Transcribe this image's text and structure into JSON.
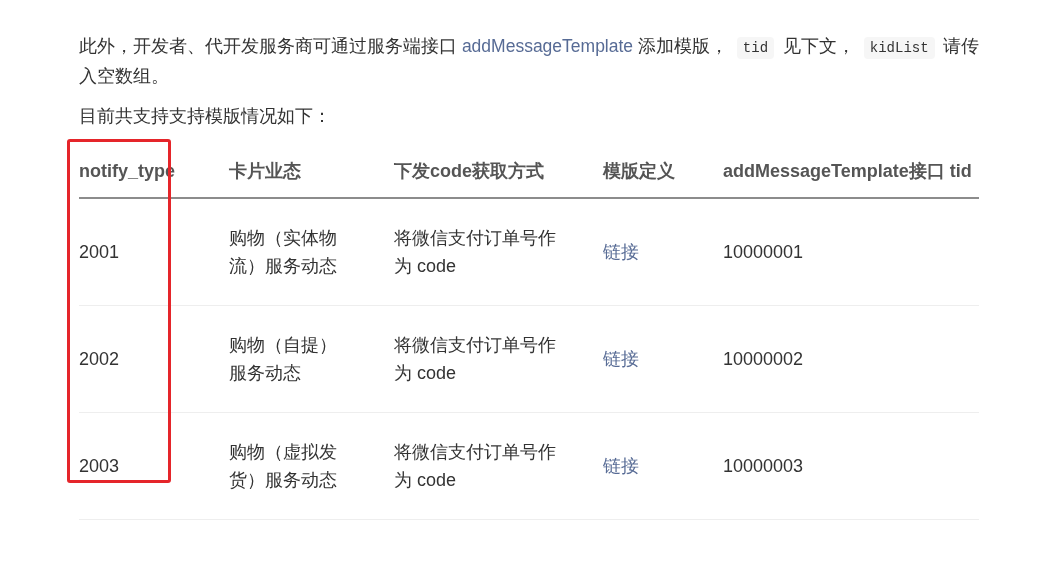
{
  "intro": [
    {
      "kind": "text",
      "text": "此外，开发者、代开发服务商可通过服务端接口 "
    },
    {
      "kind": "link",
      "text": "addMessageTemplate"
    },
    {
      "kind": "text",
      "text": " 添加模版， "
    },
    {
      "kind": "code",
      "text": "tid"
    },
    {
      "kind": "text",
      "text": " 见下文， "
    },
    {
      "kind": "code",
      "text": "kidList"
    },
    {
      "kind": "text",
      "text": " 请传入空数组。"
    }
  ],
  "lead": "目前共支持支持模版情况如下：",
  "annotation": {
    "kind": "frame"
  },
  "table": {
    "columns": [
      {
        "label": "notify_type"
      },
      {
        "label": "卡片业态"
      },
      {
        "label": "下发code获取方式"
      },
      {
        "label": "模版定义"
      },
      {
        "label": "addMessageTemplate接口 tid"
      }
    ],
    "rows": [
      [
        {
          "kind": "text",
          "text": "2001"
        },
        {
          "kind": "text",
          "text": "购物（实体物流）服务动态"
        },
        {
          "kind": "text",
          "text": "将微信支付订单号作为 code"
        },
        {
          "kind": "link",
          "text": "链接"
        },
        {
          "kind": "text",
          "text": "10000001"
        }
      ],
      [
        {
          "kind": "text",
          "text": "2002"
        },
        {
          "kind": "text",
          "text": "购物（自提）服务动态"
        },
        {
          "kind": "text",
          "text": "将微信支付订单号作为 code"
        },
        {
          "kind": "link",
          "text": "链接"
        },
        {
          "kind": "text",
          "text": "10000002"
        }
      ],
      [
        {
          "kind": "text",
          "text": "2003"
        },
        {
          "kind": "text",
          "text": "购物（虚拟发货）服务动态"
        },
        {
          "kind": "text",
          "text": "将微信支付订单号作为 code"
        },
        {
          "kind": "link",
          "text": "链接"
        },
        {
          "kind": "text",
          "text": "10000003"
        }
      ]
    ]
  }
}
